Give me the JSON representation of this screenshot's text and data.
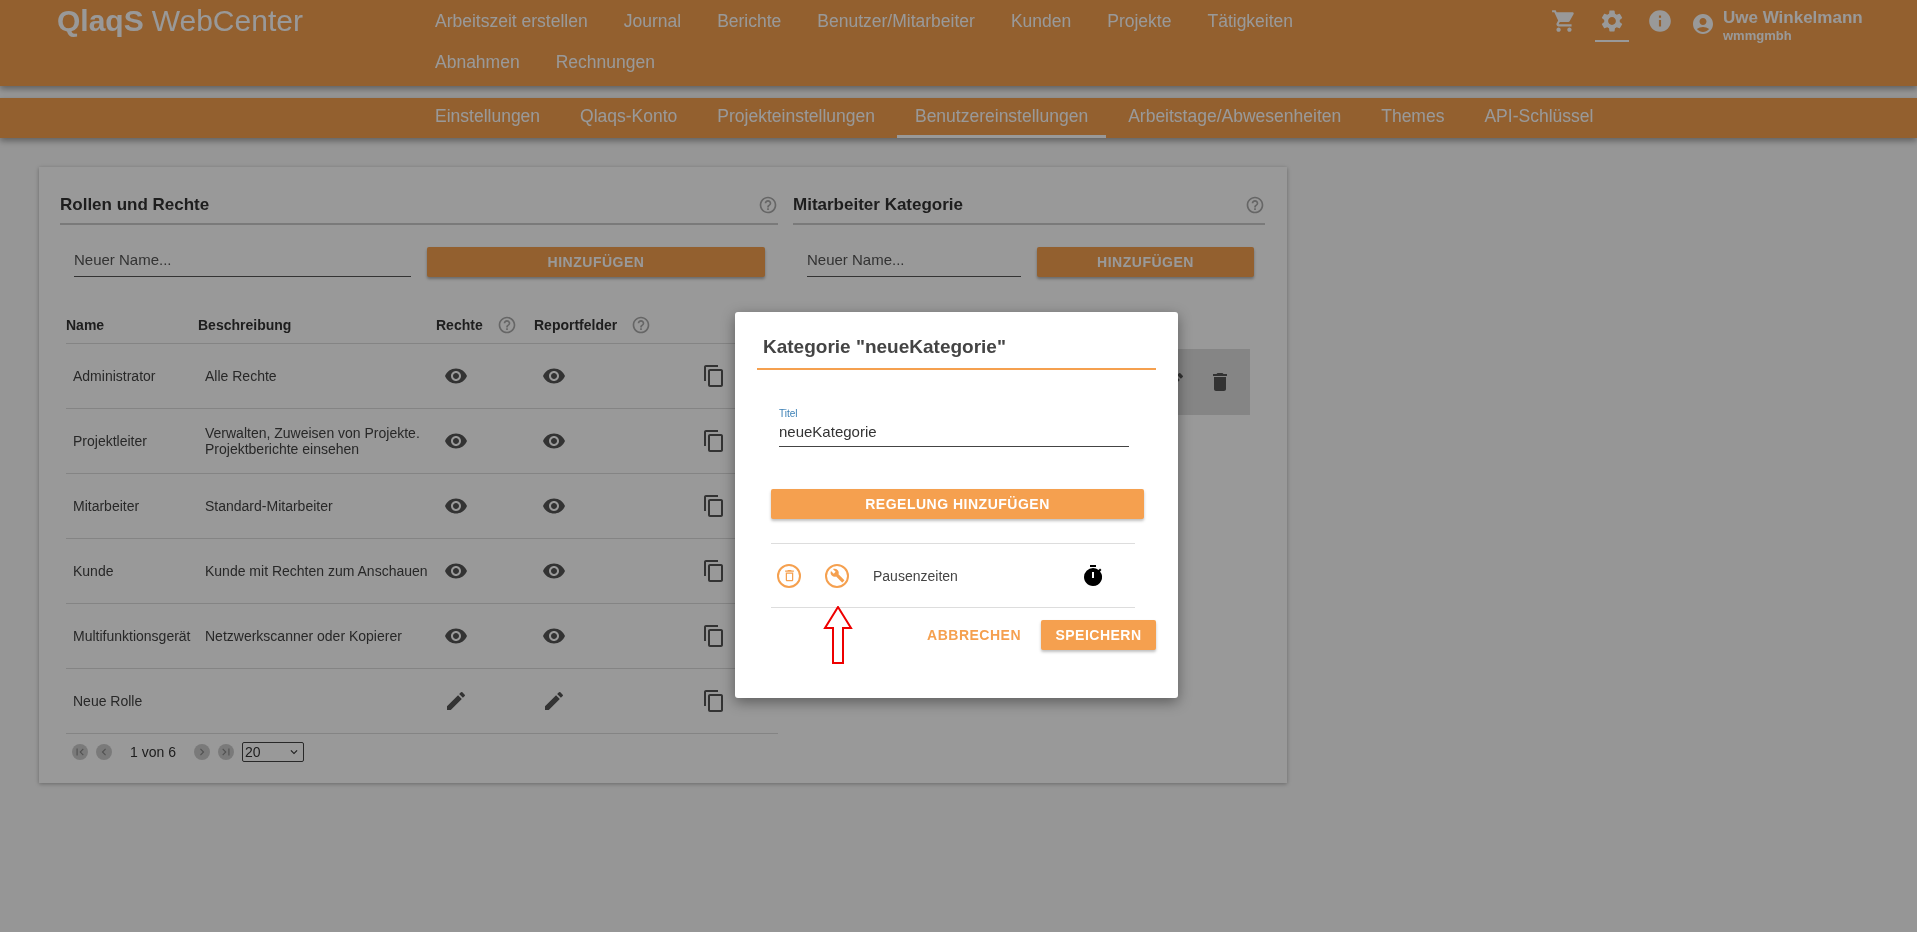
{
  "header": {
    "logo": "QlaqS",
    "logo_suffix": "WebCenter",
    "nav": [
      "Arbeitszeit erstellen",
      "Journal",
      "Berichte",
      "Benutzer/Mitarbeiter",
      "Kunden",
      "Projekte",
      "Tätigkeiten",
      "Abnahmen",
      "Rechnungen"
    ],
    "toolbar_icons": [
      {
        "kind": "cart",
        "selected": false
      },
      {
        "kind": "settings",
        "selected": true
      },
      {
        "kind": "info",
        "selected": false
      }
    ],
    "user": {
      "name": "Uwe Winkelmann",
      "company": "wmmgmbh"
    }
  },
  "subnav": [
    {
      "label": "Einstellungen",
      "selected": false
    },
    {
      "label": "Qlaqs-Konto",
      "selected": false
    },
    {
      "label": "Projekteinstellungen",
      "selected": false
    },
    {
      "label": "Benutzereinstellungen",
      "selected": true
    },
    {
      "label": "Arbeitstage/Abwesenheiten",
      "selected": false
    },
    {
      "label": "Themes",
      "selected": false
    },
    {
      "label": "API-Schlüssel",
      "selected": false
    }
  ],
  "roles_panel": {
    "title": "Rollen und Rechte",
    "input": {
      "placeholder": "Neuer Name..."
    },
    "add_button": "HINZUFÜGEN",
    "columns": [
      {
        "label": "Name",
        "help": false
      },
      {
        "label": "Beschreibung",
        "help": false
      },
      {
        "label": "Rechte",
        "help": true
      },
      {
        "label": "Reportfelder",
        "help": true
      }
    ],
    "rows": [
      {
        "name": "Administrator",
        "description": "Alle Rechte",
        "kind": "view"
      },
      {
        "name": "Projektleiter",
        "description": "Verwalten, Zuweisen von Projekte. Projektberichte einsehen",
        "kind": "view"
      },
      {
        "name": "Mitarbeiter",
        "description": "Standard-Mitarbeiter",
        "kind": "view"
      },
      {
        "name": "Kunde",
        "description": "Kunde mit Rechten zum Anschauen",
        "kind": "view"
      },
      {
        "name": "Multifunktionsgerät",
        "description": "Netzwerkscanner oder Kopierer",
        "kind": "view"
      },
      {
        "name": "Neue Rolle",
        "kind": "edit"
      }
    ],
    "pagination": {
      "page_text": "1 von 6",
      "page_size": "20"
    }
  },
  "category_panel": {
    "title": "Mitarbeiter Kategorie",
    "input": {
      "placeholder": "Neuer Name..."
    },
    "add_button": "HINZUFÜGEN"
  },
  "dialog": {
    "title": "Kategorie \"neueKategorie\"",
    "field": {
      "label": "Titel",
      "value": "neueKategorie"
    },
    "add_rule_button": "REGELUNG HINZUFÜGEN",
    "rules": [
      {
        "name": "Pausenzeiten",
        "kind": "timer"
      }
    ],
    "cancel_button": "ABBRECHEN",
    "save_button": "SPEICHERN"
  }
}
